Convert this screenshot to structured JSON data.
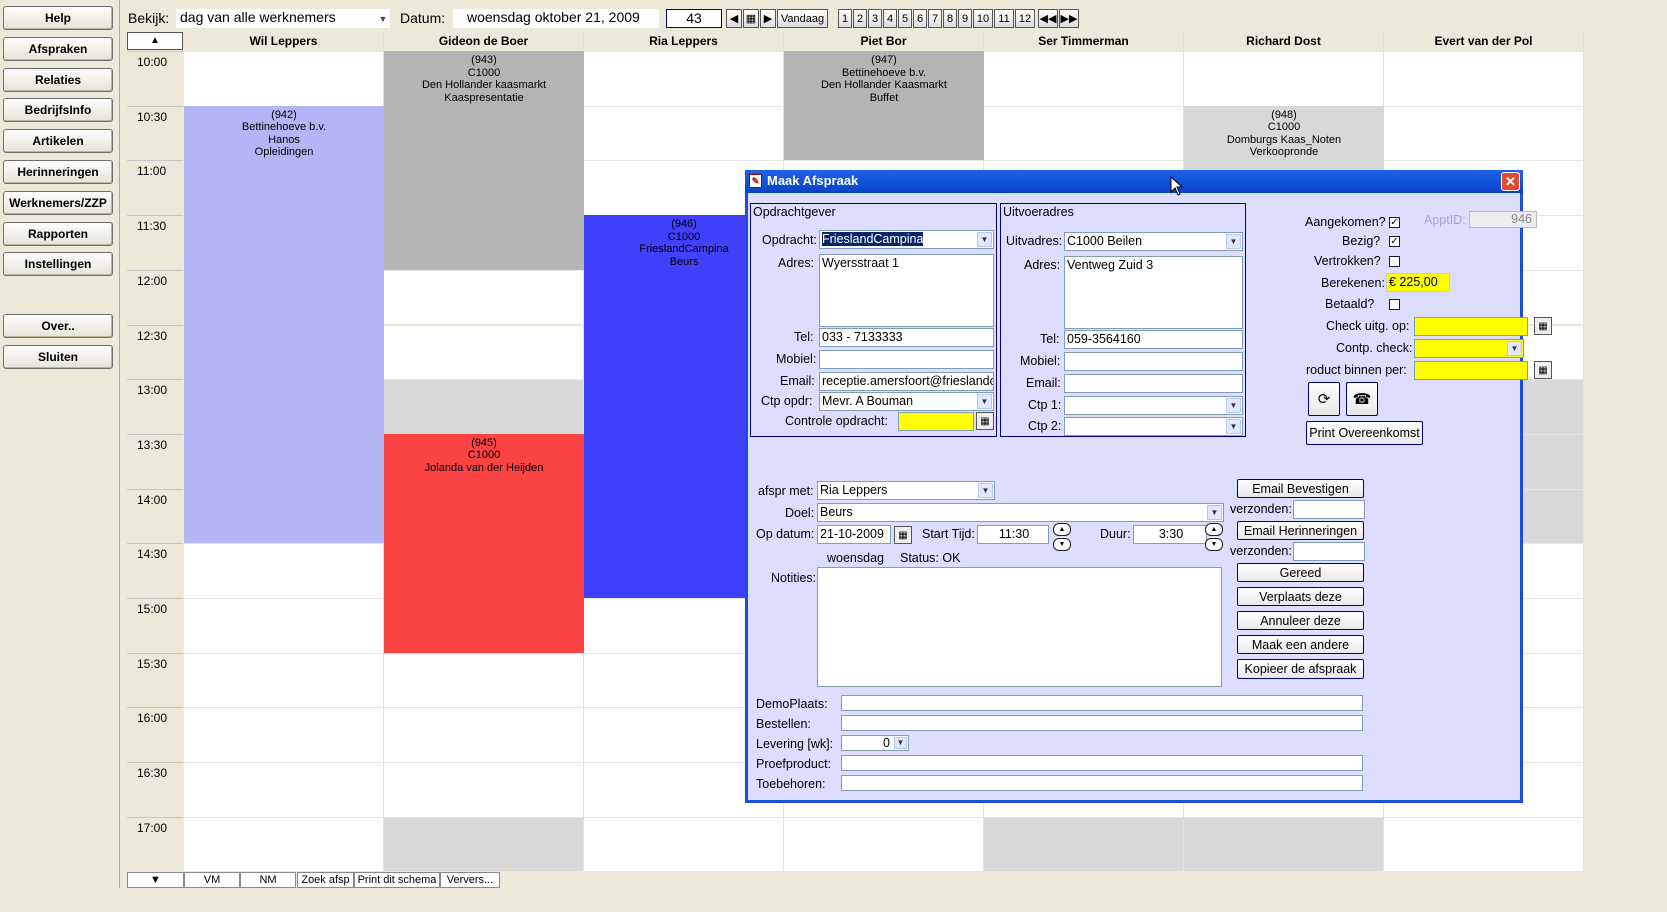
{
  "sidebar": {
    "help": "Help",
    "afspraken": "Afspraken",
    "relaties": "Relaties",
    "bedrijfsinfo": "BedrijfsInfo",
    "artikelen": "Artikelen",
    "herinneringen": "Herinneringen",
    "werknemers": "Werknemers/ZZP",
    "rapporten": "Rapporten",
    "instellingen": "Instellingen",
    "over": "Over..",
    "sluiten": "Sluiten"
  },
  "topbar": {
    "bekijk_label": "Bekijk:",
    "bekijk_value": "dag van alle werknemers",
    "datum_label": "Datum:",
    "datum_value": "woensdag oktober 21, 2009",
    "week": "43",
    "vandaag": "Vandaag",
    "months": [
      "1",
      "2",
      "3",
      "4",
      "5",
      "6",
      "7",
      "8",
      "9",
      "10",
      "11",
      "12"
    ]
  },
  "columns": [
    "Wil Leppers",
    "Gideon de Boer",
    "Ria Leppers",
    "Piet Bor",
    "Ser Timmerman",
    "Richard Dost",
    "Evert van der Pol"
  ],
  "times": [
    "10:00",
    "10:30",
    "11:00",
    "11:30",
    "12:00",
    "12:30",
    "13:00",
    "13:30",
    "14:00",
    "14:30",
    "15:00",
    "15:30",
    "16:00",
    "16:30",
    "17:00"
  ],
  "appointments": {
    "a942": [
      "(942)",
      "Bettinehoeve b.v.",
      "Hanos",
      "Opleidingen"
    ],
    "a943": [
      "(943)",
      "C1000",
      "Den Hollander kaasmarkt",
      "Kaaspresentatie"
    ],
    "a946": [
      "(946)",
      "C1000",
      "FrieslandCampina",
      "Beurs"
    ],
    "a947": [
      "(947)",
      "Bettinehoeve b.v.",
      "Den Hollander Kaasmarkt",
      "Buffet"
    ],
    "a948": [
      "(948)",
      "C1000",
      "Domburgs Kaas_Noten",
      "Verkoopronde"
    ],
    "a945": [
      "(945)",
      "C1000",
      "Jolanda van der Heijden"
    ]
  },
  "bottombar": {
    "vm": "VM",
    "nm": "NM",
    "zoek": "Zoek afsp",
    "print": "Print dit schema",
    "ververs": "Ververs..."
  },
  "dialog": {
    "title": "Maak Afspraak",
    "opdrachtgever": {
      "heading": "Opdrachtgever",
      "opdracht_label": "Opdracht:",
      "opdracht": "FrieslandCampina",
      "adres_label": "Adres:",
      "adres": "Wyersstraat 1",
      "tel_label": "Tel:",
      "tel": "033 - 7133333",
      "mobiel_label": "Mobiel:",
      "mobiel": "",
      "email_label": "Email:",
      "email": "receptie.amersfoort@frieslandca",
      "ctp_label": "Ctp opdr:",
      "ctp": "Mevr. A Bouman",
      "controle_label": "Controle opdracht:"
    },
    "uitvoeradres": {
      "heading": "Uitvoeradres",
      "uitvadres_label": "Uitvadres:",
      "uitvadres": "C1000 Beilen",
      "adres_label": "Adres:",
      "adres": "Ventweg Zuid 3",
      "tel_label": "Tel:",
      "tel": "059-3564160",
      "mobiel_label": "Mobiel:",
      "email_label": "Email:",
      "ctp1_label": "Ctp 1:",
      "ctp2_label": "Ctp 2:"
    },
    "status": {
      "aangekomen_label": "Aangekomen?",
      "bezig_label": "Bezig?",
      "vertrokken_label": "Vertrokken?",
      "berekenen_label": "Berekenen:",
      "berekenen": "€ 225,00",
      "betaald_label": "Betaald?",
      "apptid_label": "ApptID:",
      "apptid": "946",
      "check_label": "Check uitg. op:",
      "contp_label": "Contp. check:",
      "product_label": "roduct binnen per:",
      "print_overeenkomst": "Print Overeenkomst",
      "aangekomen": true,
      "bezig": true,
      "vertrokken": false,
      "betaald": false
    },
    "afspraak": {
      "met_label": "afspr met:",
      "met": "Ria Leppers",
      "doel_label": "Doel:",
      "doel": "Beurs",
      "datum_label": "Op datum:",
      "datum": "21-10-2009",
      "start_label": "Start Tijd:",
      "start": "11:30",
      "duur_label": "Duur:",
      "duur": "3:30",
      "weekday": "woensdag",
      "status": "Status: OK",
      "notities_label": "Notities:"
    },
    "buttons": {
      "email_bevestigen": "Email Bevestigen",
      "verzonden1": "verzonden:",
      "email_herinneringen": "Email Herinneringen",
      "verzonden2": "verzonden:",
      "gereed": "Gereed",
      "verplaats": "Verplaats deze",
      "annuleer": "Annuleer deze",
      "maak_andere": "Maak een andere",
      "kopieer": "Kopieer de afspraak"
    },
    "extra": {
      "demoplaats_label": "DemoPlaats:",
      "bestellen_label": "Bestellen:",
      "levering_label": "Levering [wk]:",
      "levering": "0",
      "proefproduct_label": "Proefproduct:",
      "toebehoren_label": "Toebehoren:"
    }
  },
  "colors": {
    "lavender": "#b3b5f5",
    "gray": "#b4b4b4",
    "blue": "#4040fd",
    "red": "#fc4343",
    "lightgray": "#d8d8d8",
    "dialog_bg": "#ddddff",
    "yellow": "#ffff00"
  }
}
